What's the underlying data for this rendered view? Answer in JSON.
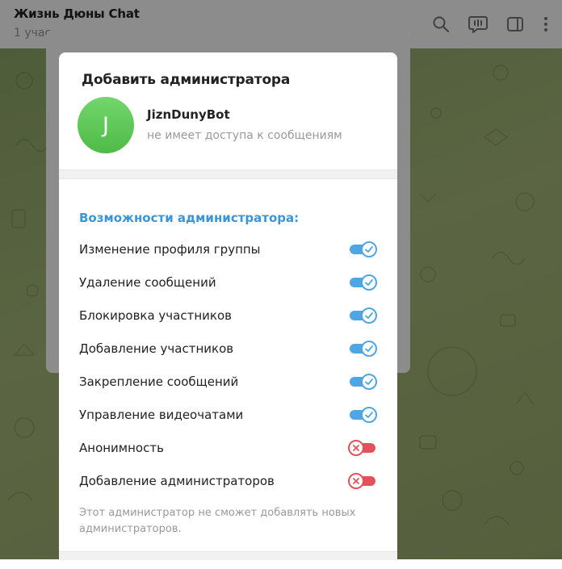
{
  "topbar": {
    "title": "Жизнь Дюны Chat",
    "subtitle": "1 учас",
    "icons": [
      "search-icon",
      "video-chat-icon",
      "sidebar-toggle-icon",
      "more-vertical-icon"
    ]
  },
  "dialog": {
    "title": "Добавить администратора",
    "avatar_letter": "J",
    "bot_name": "JiznDunyBot",
    "bot_status": "не имеет доступа к сообщениям",
    "section_title": "Возможности администратора:",
    "permissions": [
      {
        "label": "Изменение профиля группы",
        "enabled": true
      },
      {
        "label": "Удаление сообщений",
        "enabled": true
      },
      {
        "label": "Блокировка участников",
        "enabled": true
      },
      {
        "label": "Добавление участников",
        "enabled": true
      },
      {
        "label": "Закрепление сообщений",
        "enabled": true
      },
      {
        "label": "Управление видеочатами",
        "enabled": true
      },
      {
        "label": "Анонимность",
        "enabled": false
      },
      {
        "label": "Добавление администраторов",
        "enabled": false
      }
    ],
    "note": "Этот администратор не сможет добавлять новых администраторов."
  },
  "colors": {
    "accent": "#3a95d6",
    "toggle_on": "#4fa6e3",
    "toggle_off": "#e3515d",
    "avatar": "#5cc755"
  }
}
